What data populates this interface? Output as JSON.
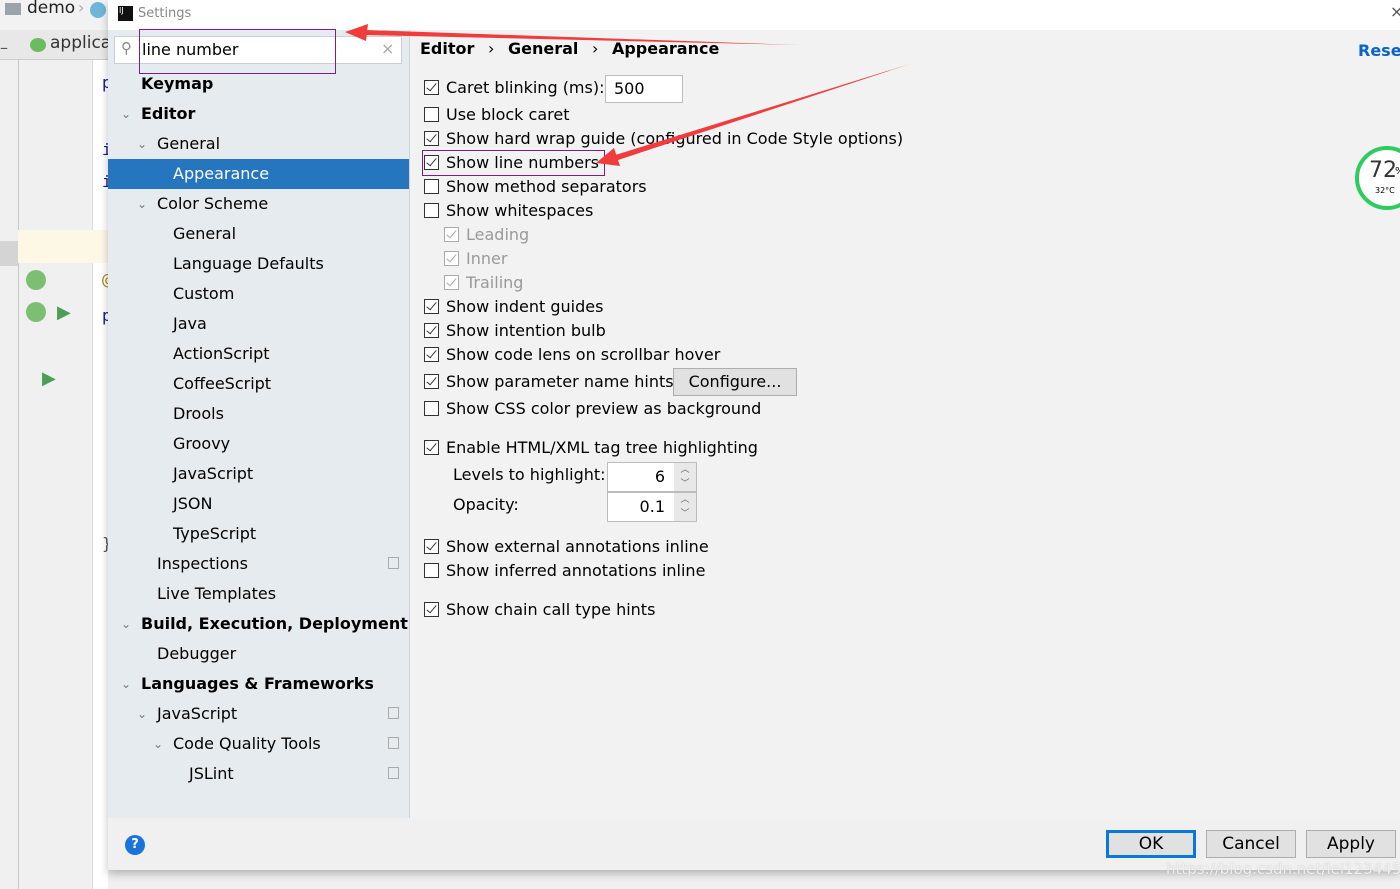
{
  "ide": {
    "project": "demo",
    "tab": "applicat",
    "code_chars": [
      "p",
      "i",
      "i",
      "@",
      "p",
      "}"
    ]
  },
  "dialog": {
    "title": "Settings",
    "search": {
      "value": "line number"
    },
    "reset_label": "Reset"
  },
  "breadcrumb": [
    "Editor",
    "General",
    "Appearance"
  ],
  "tree": [
    {
      "label": "Keymap",
      "level": 0,
      "bold": true
    },
    {
      "label": "Editor",
      "level": 0,
      "bold": true,
      "expanded": true
    },
    {
      "label": "General",
      "level": 1,
      "expanded": true
    },
    {
      "label": "Appearance",
      "level": 2,
      "selected": true
    },
    {
      "label": "Color Scheme",
      "level": 1,
      "expanded": true
    },
    {
      "label": "General",
      "level": 2
    },
    {
      "label": "Language Defaults",
      "level": 2
    },
    {
      "label": "Custom",
      "level": 2
    },
    {
      "label": "Java",
      "level": 2
    },
    {
      "label": "ActionScript",
      "level": 2
    },
    {
      "label": "CoffeeScript",
      "level": 2
    },
    {
      "label": "Drools",
      "level": 2
    },
    {
      "label": "Groovy",
      "level": 2
    },
    {
      "label": "JavaScript",
      "level": 2
    },
    {
      "label": "JSON",
      "level": 2
    },
    {
      "label": "TypeScript",
      "level": 2
    },
    {
      "label": "Inspections",
      "level": 1,
      "copy": true
    },
    {
      "label": "Live Templates",
      "level": 1
    },
    {
      "label": "Build, Execution, Deployment",
      "level": 0,
      "bold": true,
      "expanded": true
    },
    {
      "label": "Debugger",
      "level": 1
    },
    {
      "label": "Languages & Frameworks",
      "level": 0,
      "bold": true,
      "expanded": true
    },
    {
      "label": "JavaScript",
      "level": 1,
      "expanded": true,
      "copy": true
    },
    {
      "label": "Code Quality Tools",
      "level": 2,
      "expanded": true,
      "copy": true
    },
    {
      "label": "JSLint",
      "level": 3,
      "copy": true
    }
  ],
  "options": [
    {
      "label": "Caret blinking (ms):",
      "checked": true,
      "value": "500"
    },
    {
      "label": "Use block caret",
      "checked": false
    },
    {
      "label": "Show hard wrap guide (configured in Code Style options)",
      "checked": true
    },
    {
      "label": "Show line numbers",
      "checked": true,
      "highlighted": true
    },
    {
      "label": "Show method separators",
      "checked": false
    },
    {
      "label": "Show whitespaces",
      "checked": false
    },
    {
      "label": "Leading",
      "checked": true,
      "disabled": true
    },
    {
      "label": "Inner",
      "checked": true,
      "disabled": true
    },
    {
      "label": "Trailing",
      "checked": true,
      "disabled": true
    },
    {
      "label": "Show indent guides",
      "checked": true
    },
    {
      "label": "Show intention bulb",
      "checked": true
    },
    {
      "label": "Show code lens on scrollbar hover",
      "checked": true
    },
    {
      "label": "Show parameter name hints",
      "checked": true,
      "button": "Configure..."
    },
    {
      "label": "Show CSS color preview as background",
      "checked": false
    },
    {
      "label": "Enable HTML/XML tag tree highlighting",
      "checked": true
    },
    {
      "label": "Show external annotations inline",
      "checked": true
    },
    {
      "label": "Show inferred annotations inline",
      "checked": false
    },
    {
      "label": "Show chain call type hints",
      "checked": true
    }
  ],
  "levels": {
    "label": "Levels to highlight:",
    "value": "6"
  },
  "opacity": {
    "label": "Opacity:",
    "value": "0.1"
  },
  "buttons": {
    "ok": "OK",
    "cancel": "Cancel",
    "apply": "Apply",
    "help": "?"
  },
  "widget": {
    "percent": "72",
    "percent_sign": "%",
    "temp": "32°C",
    "level": 0.72
  },
  "watermark": "https://blog.csdn.net/lei1234456",
  "colors": {
    "selection": "#2675bf",
    "link": "#0b63c5",
    "annotation_arrow": "#f03c3c",
    "highlight_box": "#7b1f86",
    "gauge": "#2ecc5f"
  }
}
